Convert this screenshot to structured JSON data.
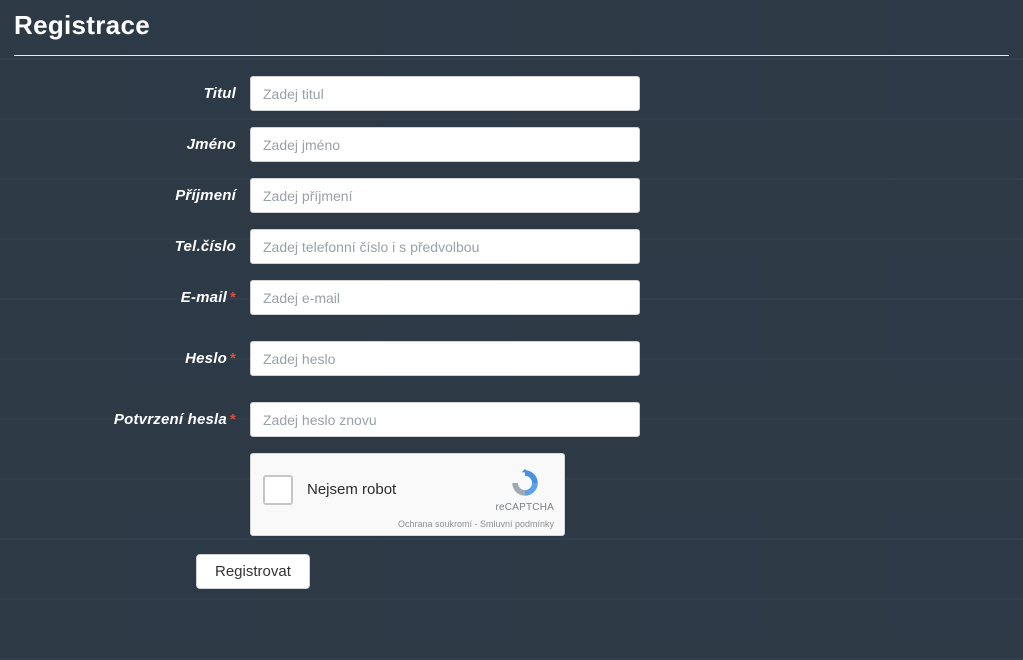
{
  "title": "Registrace",
  "fields": {
    "title_label": "Titul",
    "title_placeholder": "Zadej titul",
    "firstname_label": "Jméno",
    "firstname_placeholder": "Zadej jméno",
    "surname_label": "Příjmení",
    "surname_placeholder": "Zadej příjmení",
    "phone_label": "Tel.číslo",
    "phone_placeholder": "Zadej telefonní číslo i s předvolbou",
    "email_label": "E-mail",
    "email_placeholder": "Zadej e-mail",
    "password_label": "Heslo",
    "password_placeholder": "Zadej heslo",
    "password_confirm_label": "Potvrzení hesla",
    "password_confirm_placeholder": "Zadej heslo znovu"
  },
  "required_marker": "*",
  "captcha": {
    "label": "Nejsem robot",
    "brand": "reCAPTCHA",
    "privacy": "Ochrana soukromí",
    "sep": " - ",
    "terms": "Smluvní podmínky"
  },
  "submit_label": "Registrovat"
}
